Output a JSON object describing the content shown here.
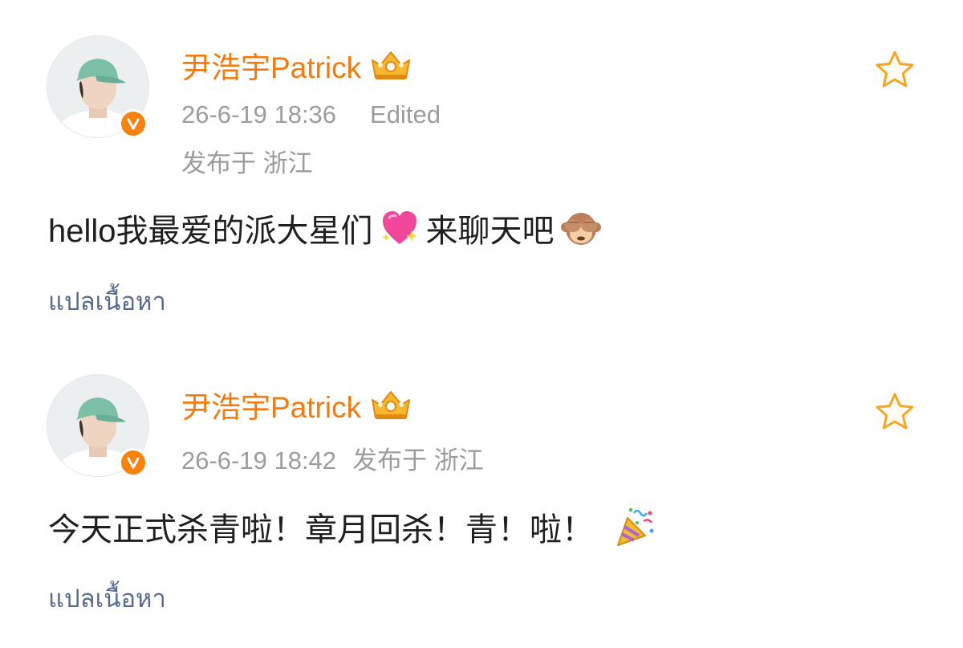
{
  "posts": [
    {
      "username": "尹浩宇Patrick",
      "timestamp": "26-6-19 18:36",
      "edited_label": "Edited",
      "location": "发布于 浙江",
      "content_text_1": "hello我最爱的派大星们",
      "content_text_2": "来聊天吧",
      "emojis": [
        "sparkling-heart-emoji",
        "see-no-evil-monkey-emoji"
      ],
      "translate_label": "แปลเนื้อหา"
    },
    {
      "username": "尹浩宇Patrick",
      "timestamp": "26-6-19 18:42",
      "location": "发布于 浙江",
      "content_text_1": "今天正式杀青啦！章月回杀！青！啦！",
      "emojis": [
        "party-popper-emoji"
      ],
      "translate_label": "แปลเนื้อหา"
    }
  ],
  "colors": {
    "username": "#f47a0e",
    "meta": "#9c9c9c",
    "content": "#1f1f1f",
    "translate_link": "#566b8f",
    "verified_badge": "#f7820e",
    "star_outline": "#f5a623"
  },
  "icons": {
    "verified": "verified-v-icon",
    "crown": "crown-badge-icon",
    "star": "star-outline-icon"
  }
}
